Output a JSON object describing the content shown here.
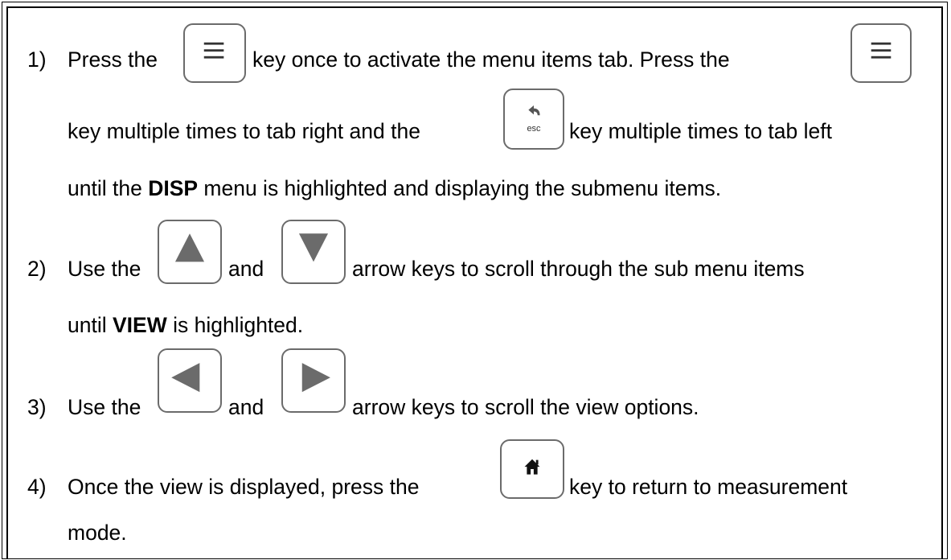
{
  "steps": [
    {
      "number": "1)",
      "line1_a": "Press the",
      "line1_b": "key once to activate the menu items tab.  Press the",
      "line2_a": "key multiple times to tab right and the",
      "line2_b": "key multiple times to tab left",
      "line3_a": "until the ",
      "line3_bold": "DISP",
      "line3_b": " menu is highlighted and displaying the submenu items."
    },
    {
      "number": "2)",
      "line1_a": "Use the",
      "line1_and": "and",
      "line1_b": "arrow keys to scroll through the sub menu items",
      "line2_a": "until ",
      "line2_bold": "VIEW",
      "line2_b": " is highlighted."
    },
    {
      "number": "3)",
      "line1_a": "Use the",
      "line1_and": "and",
      "line1_b": "arrow keys to scroll the view options."
    },
    {
      "number": "4)",
      "line1_a": "Once the view is displayed, press the",
      "line1_b": "key to return to measurement",
      "line2": "mode."
    }
  ],
  "keys": {
    "menu": "menu-icon",
    "esc": "esc",
    "up": "up-arrow-icon",
    "down": "down-arrow-icon",
    "left": "left-arrow-icon",
    "right": "right-arrow-icon",
    "home": "home-icon"
  },
  "colors": {
    "key_glyph": "#6b6b6b",
    "key_border": "#6b6b6b"
  }
}
